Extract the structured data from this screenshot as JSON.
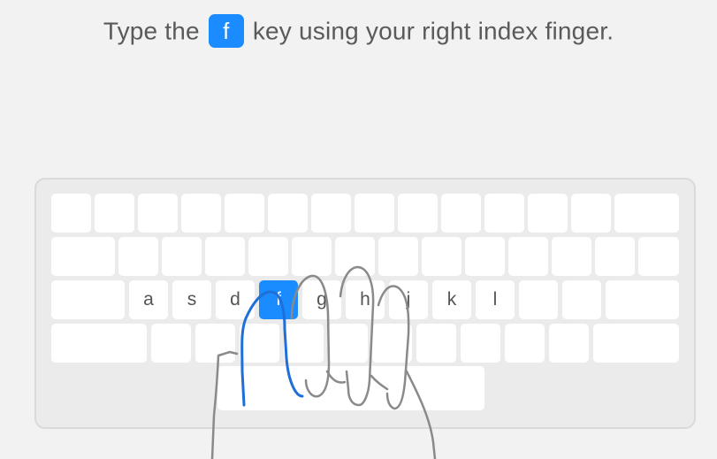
{
  "instruction": {
    "prefix": "Type the",
    "key": "f",
    "suffix": "key using your right index finger."
  },
  "keyboard": {
    "home_row": {
      "a": "a",
      "s": "s",
      "d": "d",
      "f": "f",
      "g": "g",
      "h": "h",
      "j": "j",
      "k": "k",
      "l": "l"
    }
  },
  "colors": {
    "accent": "#1a8cff",
    "background": "#f2f2f2",
    "key": "#ffffff",
    "key_text": "#555555",
    "hand_outline": "#888888",
    "active_finger": "#1e6fd9"
  },
  "icons": {
    "hand": "hand-outline-icon"
  }
}
